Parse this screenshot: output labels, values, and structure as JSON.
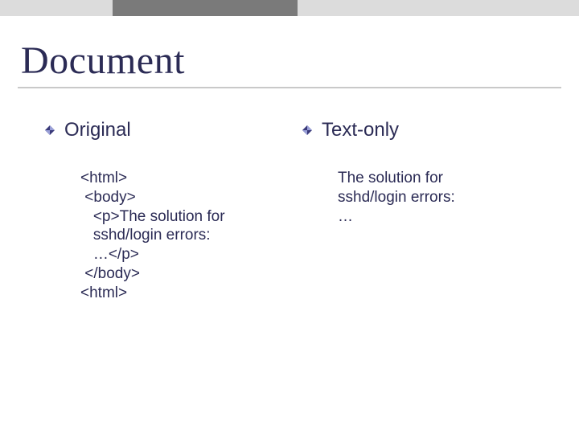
{
  "title": "Document",
  "columns": {
    "left": {
      "heading": "Original",
      "body": "<html>\n <body>\n   <p>The solution for\n   sshd/login errors:\n   …</p>\n </body>\n<html>"
    },
    "right": {
      "heading": "Text-only",
      "body": "The solution for\nsshd/login errors:\n…"
    }
  }
}
